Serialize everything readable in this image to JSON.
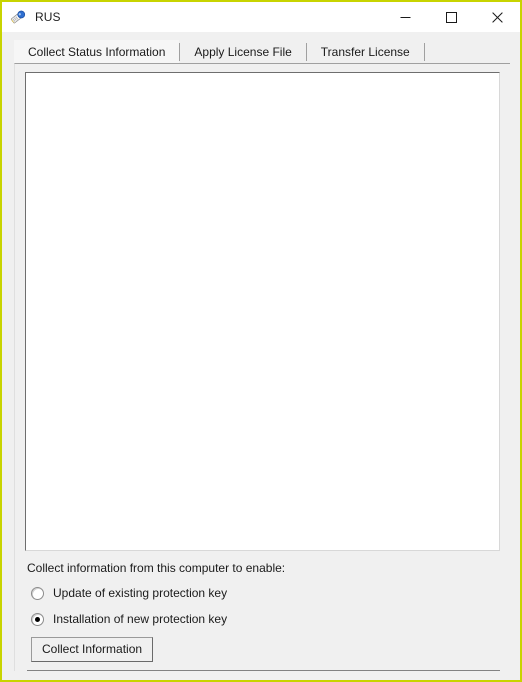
{
  "window": {
    "title": "RUS",
    "icon": "protection-key-icon",
    "accent_border_color": "#c8d400",
    "titlebar_background": "#ffffff",
    "client_background": "#f0f0f0",
    "controls": {
      "minimize_label": "Minimize",
      "maximize_label": "Maximize",
      "close_label": "Close"
    }
  },
  "tabs": [
    {
      "label": "Collect Status Information",
      "selected": true
    },
    {
      "label": "Apply License File",
      "selected": false
    },
    {
      "label": "Transfer License",
      "selected": false
    }
  ],
  "main": {
    "output_textarea": {
      "value": "",
      "placeholder": ""
    },
    "prompt_label": "Collect information from this computer to enable:",
    "radio_options": [
      {
        "label": "Update of existing protection key",
        "checked": false
      },
      {
        "label": "Installation of new protection key",
        "checked": true
      }
    ],
    "collect_button_label": "Collect Information"
  }
}
